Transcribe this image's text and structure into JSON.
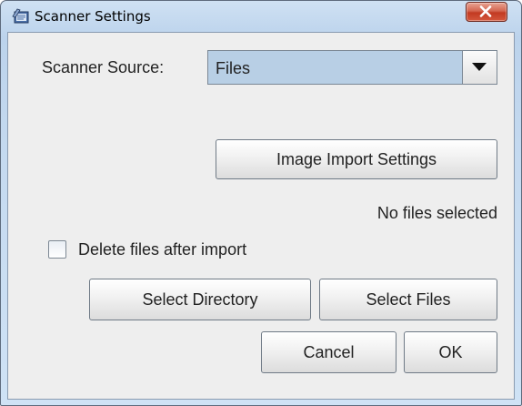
{
  "window": {
    "title": "Scanner Settings"
  },
  "form": {
    "source_label": "Scanner Source:",
    "source_value": "Files",
    "import_settings_label": "Image Import Settings",
    "status_text": "No files selected",
    "delete_checkbox_label": "Delete files after import",
    "delete_checked": false,
    "select_directory_label": "Select Directory",
    "select_files_label": "Select Files",
    "cancel_label": "Cancel",
    "ok_label": "OK"
  },
  "icons": {
    "app": "scanner-app-icon",
    "close": "close-icon",
    "dropdown": "dropdown-arrow-icon"
  },
  "colors": {
    "combo_selected_bg": "#b8cfe5",
    "close_button_red": "#c23a22",
    "title_bar_blue": "#bcd3ec"
  }
}
